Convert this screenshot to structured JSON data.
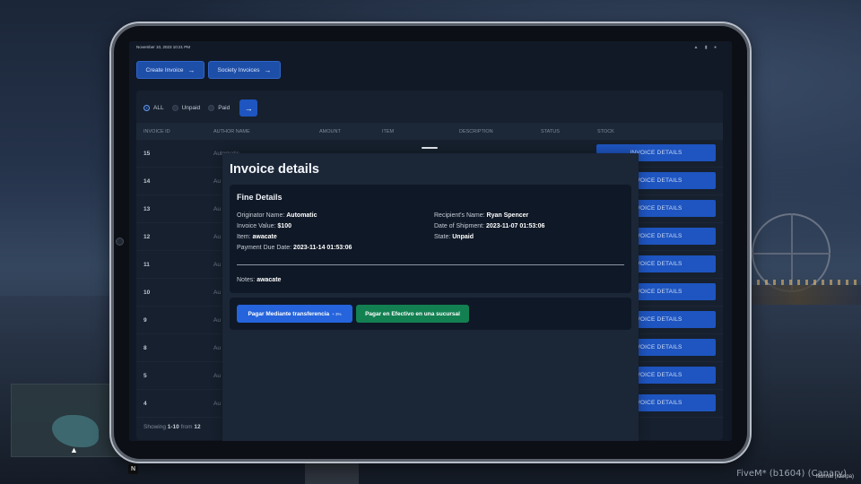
{
  "status_bar": {
    "datetime": "November 10, 2023 10:21 PM"
  },
  "toolbar": {
    "create_invoice": "Create Invoice",
    "society_invoices": "Society Invoices",
    "arrow_icon": "arrow-right-icon"
  },
  "filters": {
    "options": [
      "ALL",
      "Unpaid",
      "Paid"
    ],
    "selected": "ALL"
  },
  "table": {
    "headers": [
      "INVOICE ID",
      "AUTHOR NAME",
      "AMOUNT",
      "ITEM",
      "DESCRIPTION",
      "STATUS",
      "STOCK"
    ],
    "rows": [
      {
        "id": "15",
        "author": "Automatic",
        "action": "INVOICE DETAILS"
      },
      {
        "id": "14",
        "author": "Au",
        "action": "INVOICE DETAILS"
      },
      {
        "id": "13",
        "author": "Au",
        "action": "INVOICE DETAILS"
      },
      {
        "id": "12",
        "author": "Au",
        "action": "INVOICE DETAILS"
      },
      {
        "id": "11",
        "author": "Au",
        "action": "INVOICE DETAILS"
      },
      {
        "id": "10",
        "author": "Au",
        "action": "INVOICE DETAILS"
      },
      {
        "id": "9",
        "author": "Au",
        "action": "INVOICE DETAILS"
      },
      {
        "id": "8",
        "author": "Au",
        "action": "INVOICE DETAILS"
      },
      {
        "id": "5",
        "author": "Au",
        "action": "INVOICE DETAILS"
      },
      {
        "id": "4",
        "author": "Au",
        "action": "INVOICE DETAILS"
      }
    ],
    "showing_prefix": "Showing",
    "showing_range": "1-10",
    "showing_from": "from",
    "showing_total": "12"
  },
  "modal": {
    "title": "Invoice details",
    "card_title": "Fine Details",
    "originator_label": "Originator Name:",
    "originator_value": "Automatic",
    "invoice_value_label": "Invoice Value:",
    "invoice_value": "$100",
    "item_label": "Item:",
    "item_value": "awacate",
    "due_label": "Payment Due Date:",
    "due_value": "2023-11-14 01:53:06",
    "recipient_label": "Recipient's Name:",
    "recipient_value": "Ryan Spencer",
    "shipment_label": "Date of Shipment:",
    "shipment_value": "2023-11-07 01:53:06",
    "state_label": "State:",
    "state_value": "Unpaid",
    "notes_label": "Notes:",
    "notes_value": "awacate",
    "pay_transfer": "Pagar Mediante transferencia",
    "pay_transfer_fee": "+ 3%",
    "pay_cash": "Pagar en Efectivo en una sucursal"
  },
  "hud": {
    "fivem": "FiveM* (b1604) (Canary)",
    "fivem_sub": "Normal (Kanpa)",
    "minimap_n": "N"
  },
  "colors": {
    "accent_blue": "#1e55c0",
    "pay_green": "#138052",
    "modal_bg": "#1b2637"
  }
}
